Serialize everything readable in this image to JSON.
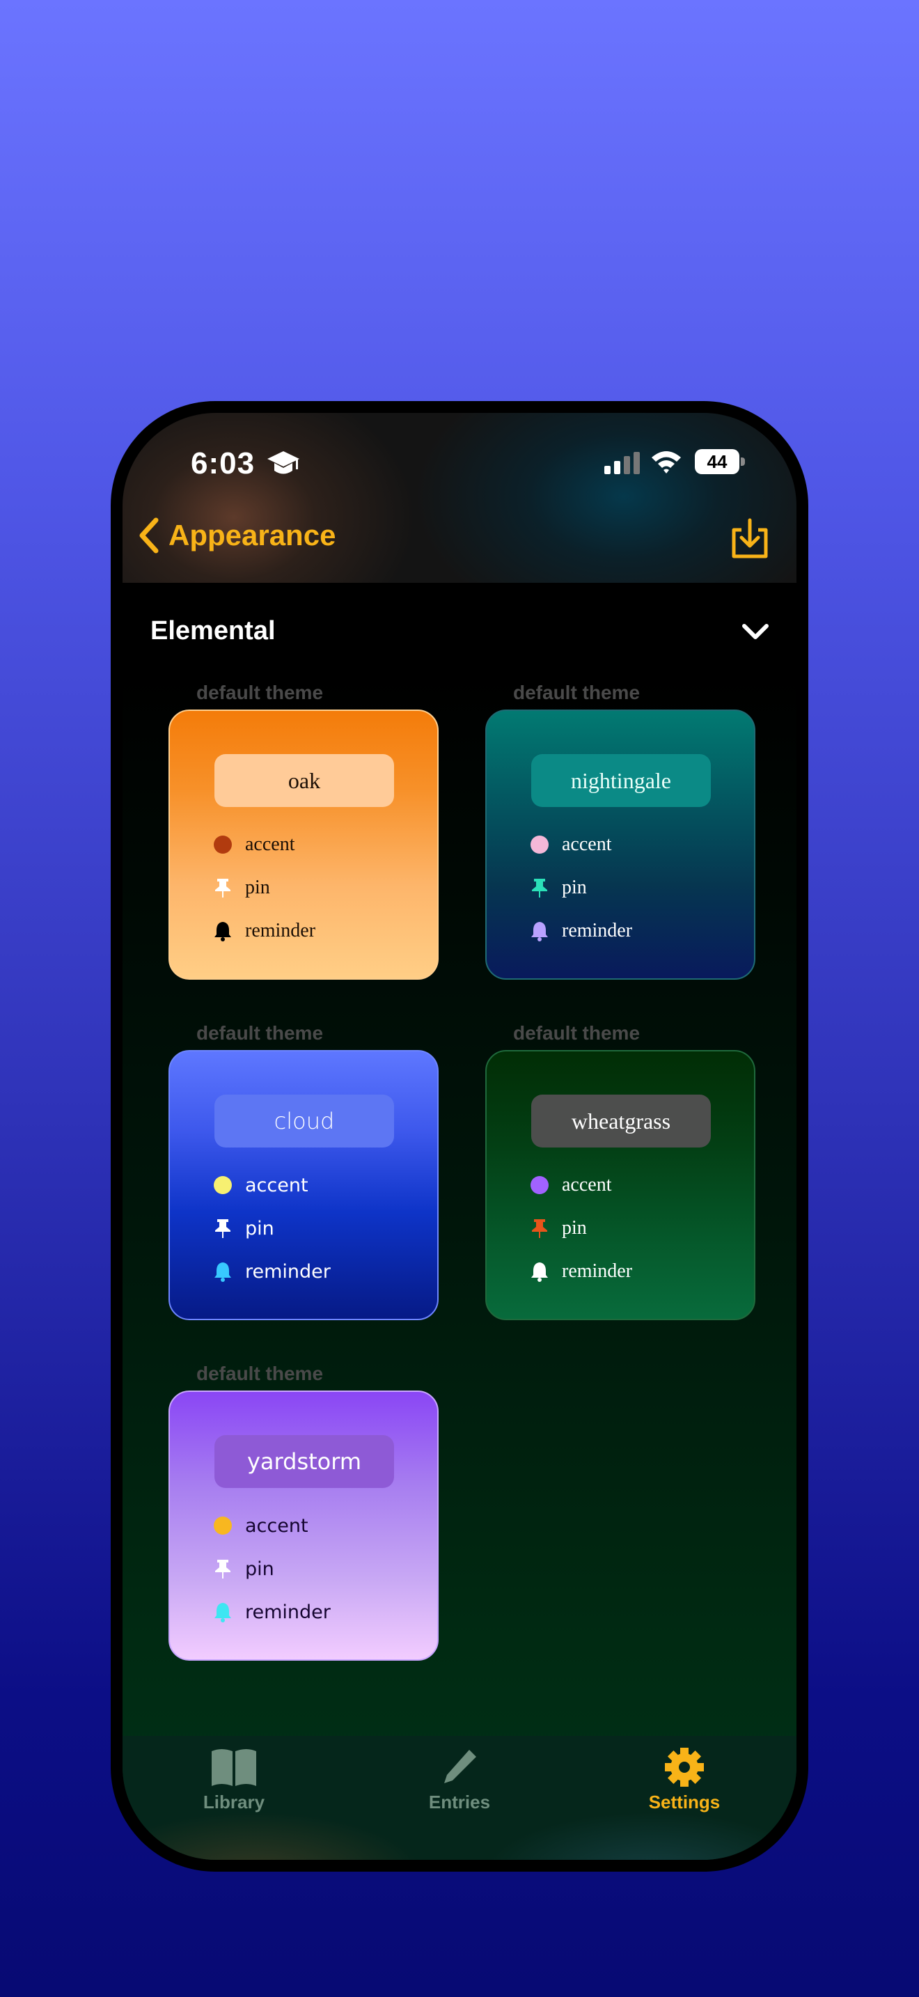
{
  "status_bar": {
    "time": "6:03",
    "battery": "44"
  },
  "nav": {
    "back_title": "Appearance",
    "export_icon": "export-icon"
  },
  "section": {
    "title": "Elemental"
  },
  "themes": [
    {
      "label": "default theme",
      "name": "oak",
      "accent_label": "accent",
      "pin_label": "pin",
      "reminder_label": "reminder",
      "accent_color": "#b13b0f",
      "pin_color": "#ffffff",
      "reminder_color": "#000000"
    },
    {
      "label": "default theme",
      "name": "nightingale",
      "accent_label": "accent",
      "pin_label": "pin",
      "reminder_label": "reminder",
      "accent_color": "#f4b8d8",
      "pin_color": "#2be0b8",
      "reminder_color": "#b9a2ff"
    },
    {
      "label": "default theme",
      "name": "cloud",
      "accent_label": "accent",
      "pin_label": "pin",
      "reminder_label": "reminder",
      "accent_color": "#f7f071",
      "pin_color": "#ffffff",
      "reminder_color": "#38c8ff"
    },
    {
      "label": "default theme",
      "name": "wheatgrass",
      "accent_label": "accent",
      "pin_label": "pin",
      "reminder_label": "reminder",
      "accent_color": "#a162ff",
      "pin_color": "#e8541a",
      "reminder_color": "#ffffff"
    },
    {
      "label": "default theme",
      "name": "yardstorm",
      "accent_label": "accent",
      "pin_label": "pin",
      "reminder_label": "reminder",
      "accent_color": "#f8b720",
      "pin_color": "#ffffff",
      "reminder_color": "#3ee6f2"
    }
  ],
  "tabs": [
    {
      "label": "Library",
      "icon": "book-icon",
      "color": "#6f8e7e"
    },
    {
      "label": "Entries",
      "icon": "pencil-icon",
      "color": "#6f8e7e"
    },
    {
      "label": "Settings",
      "icon": "gear-icon",
      "color": "#f8b318"
    }
  ]
}
